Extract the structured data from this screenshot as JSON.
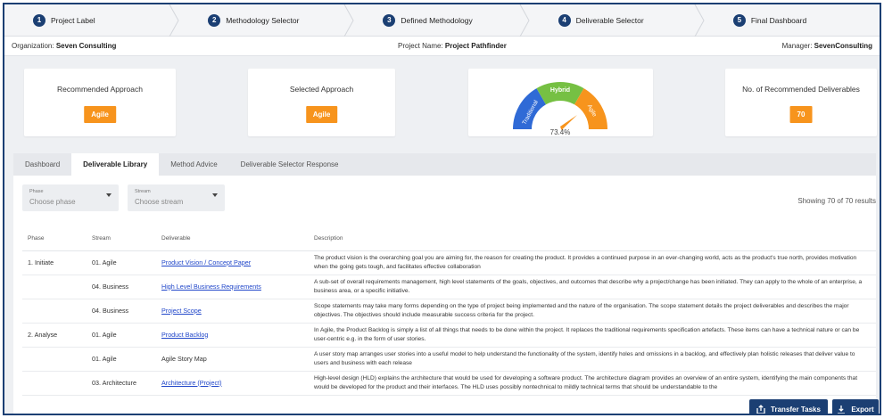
{
  "steps": [
    {
      "num": "1",
      "label": "Project Label"
    },
    {
      "num": "2",
      "label": "Methodology Selector"
    },
    {
      "num": "3",
      "label": "Defined Methodology"
    },
    {
      "num": "4",
      "label": "Deliverable Selector"
    },
    {
      "num": "5",
      "label": "Final Dashboard"
    }
  ],
  "info": {
    "org_label": "Organization:",
    "org": "Seven Consulting",
    "proj_label": "Project Name:",
    "proj": "Project Pathfinder",
    "mgr_label": "Manager:",
    "mgr": "SevenConsulting"
  },
  "cards": {
    "recommended": {
      "title": "Recommended Approach",
      "value": "Agile"
    },
    "selected": {
      "title": "Selected Approach",
      "value": "Agile"
    },
    "gauge": {
      "labels": [
        "Traditional",
        "Hybrid",
        "Agile"
      ],
      "value_text": "73.4%",
      "value": 73.4,
      "colors": [
        "#2f6ad6",
        "#76c043",
        "#f7941d"
      ]
    },
    "deliverables": {
      "title": "No. of Recommended Deliverables",
      "value": "70"
    }
  },
  "tabs": [
    "Dashboard",
    "Deliverable Library",
    "Method Advice",
    "Deliverable Selector Response"
  ],
  "active_tab": 1,
  "filters": {
    "phase": {
      "label": "Phase",
      "placeholder": "Choose phase"
    },
    "stream": {
      "label": "Stream",
      "placeholder": "Choose stream"
    },
    "results": "Showing 70 of 70 results"
  },
  "table": {
    "headers": [
      "Phase",
      "Stream",
      "Deliverable",
      "Description"
    ],
    "rows": [
      {
        "phase": "1. Initiate",
        "stream": "01. Agile",
        "deliverable": "Product Vision / Concept Paper",
        "link": true,
        "description": "The product vision is the overarching goal you are aiming for, the reason for creating the product. It provides a continued purpose in an ever-changing world, acts as the product's true north, provides motivation when the going gets tough, and facilitates effective collaboration"
      },
      {
        "phase": "",
        "stream": "04. Business",
        "deliverable": "High Level Business Requirements",
        "link": true,
        "description": "A sub-set of overall requirements management, high level statements of the goals, objectives, and outcomes that describe why a project/change has been initiated. They can apply to the whole of an enterprise, a business area, or a specific initiative."
      },
      {
        "phase": "",
        "stream": "04. Business",
        "deliverable": "Project Scope",
        "link": true,
        "description": "Scope statements may take many forms depending on the type of project being implemented and the nature of the organisation. The scope statement details the project deliverables and describes the major objectives. The objectives should include measurable success criteria for the project."
      },
      {
        "phase": "2. Analyse",
        "stream": "01. Agile",
        "deliverable": "Product Backlog",
        "link": true,
        "description": "In Agile, the Product Backlog is simply a list of all things that needs to be done within the project. It replaces the traditional requirements specification artefacts. These items can have a technical nature or can be user-centric e.g. in the form of user stories."
      },
      {
        "phase": "",
        "stream": "01. Agile",
        "deliverable": "Agile Story Map",
        "link": false,
        "description": "A user story map arranges user stories into a useful model to help understand the functionality of the system, identify holes and omissions in a backlog, and effectively plan holistic releases that deliver value to users and business with each release"
      },
      {
        "phase": "",
        "stream": "03. Architecture",
        "deliverable": "Architecture (Project)",
        "link": true,
        "description": "High-level design (HLD) explains the architecture that would be used for developing a software product. The architecture diagram provides an overview of an entire system, identifying the main components that would be developed for the product and their interfaces. The HLD uses possibly nontechnical to mildly technical terms that should be understandable to the"
      }
    ]
  },
  "buttons": {
    "transfer": "Transfer Tasks",
    "export": "Export"
  }
}
